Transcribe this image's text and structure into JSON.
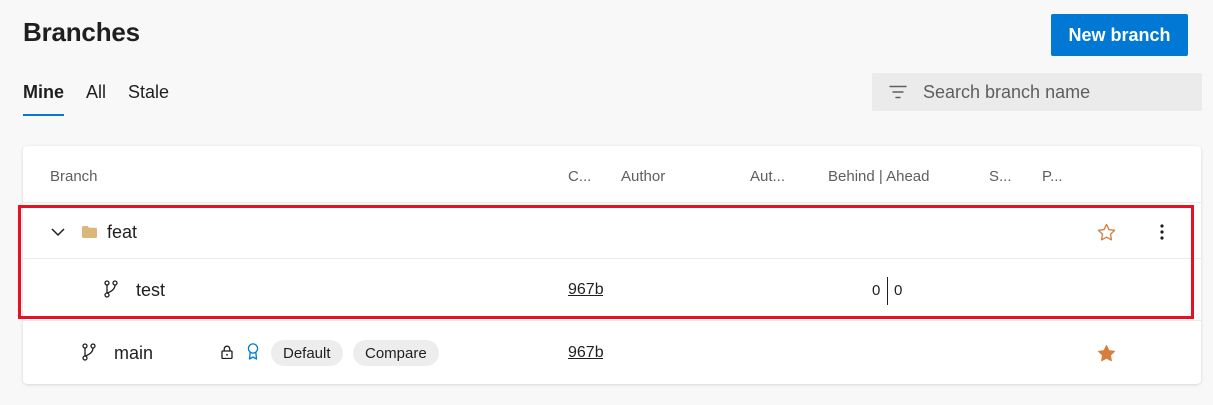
{
  "page": {
    "title": "Branches",
    "new_branch_label": "New branch"
  },
  "tabs": [
    {
      "label": "Mine",
      "active": true
    },
    {
      "label": "All",
      "active": false
    },
    {
      "label": "Stale",
      "active": false
    }
  ],
  "search": {
    "placeholder": "Search branch name",
    "value": ""
  },
  "table": {
    "columns": [
      "Branch",
      "C...",
      "Author",
      "Aut...",
      "Behind | Ahead",
      "S...",
      "P..."
    ],
    "rows": [
      {
        "type": "folder",
        "name": "feat",
        "expanded": true,
        "favorite": false,
        "icon": "folder-icon"
      },
      {
        "type": "branch",
        "name": "test",
        "commit": "967b",
        "behind": "0",
        "ahead": "0",
        "icon": "branch-icon"
      },
      {
        "type": "branch",
        "name": "main",
        "commit": "967b",
        "badges": [
          "Default",
          "Compare"
        ],
        "locked": true,
        "favorite": true,
        "icon": "branch-icon"
      }
    ]
  },
  "colors": {
    "accent": "#0078d4",
    "favorite": "#d67f3c",
    "highlight": "#e81123",
    "folder": "#dcb67a"
  }
}
